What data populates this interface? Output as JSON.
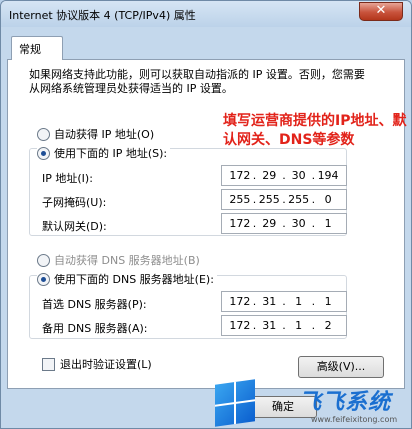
{
  "window": {
    "title": "Internet 协议版本 4 (TCP/IPv4) 属性",
    "close_label": "✕"
  },
  "tabs": [
    {
      "label": "常规"
    }
  ],
  "description": "如果网络支持此功能，则可以获取自动指派的 IP 设置。否则，您需要从网络系统管理员处获得适当的 IP 设置。",
  "annotation": "填写运营商提供的IP地址、默认网关、DNS等参数",
  "ip": {
    "auto_label": "自动获得 IP 地址(O)",
    "manual_label": "使用下面的 IP 地址(S):",
    "manual_selected": true,
    "fields": [
      {
        "label": "IP 地址(I):",
        "octets": [
          "172",
          "29",
          "30",
          "194"
        ]
      },
      {
        "label": "子网掩码(U):",
        "octets": [
          "255",
          "255",
          "255",
          "0"
        ]
      },
      {
        "label": "默认网关(D):",
        "octets": [
          "172",
          "29",
          "30",
          "1"
        ]
      }
    ]
  },
  "dns": {
    "auto_label": "自动获得 DNS 服务器地址(B)",
    "manual_label": "使用下面的 DNS 服务器地址(E):",
    "manual_selected": true,
    "fields": [
      {
        "label": "首选 DNS 服务器(P):",
        "octets": [
          "172",
          "31",
          "1",
          "1"
        ]
      },
      {
        "label": "备用 DNS 服务器(A):",
        "octets": [
          "172",
          "31",
          "1",
          "2"
        ]
      }
    ]
  },
  "validate_label": "退出时验证设置(L)",
  "advanced_label": "高级(V)...",
  "ok_label": "确定",
  "watermark": {
    "text": "飞飞系统",
    "url": "www.feifeixitong.com"
  },
  "colors": {
    "annotation": "#e2231a",
    "accent": "#1f4f96"
  }
}
